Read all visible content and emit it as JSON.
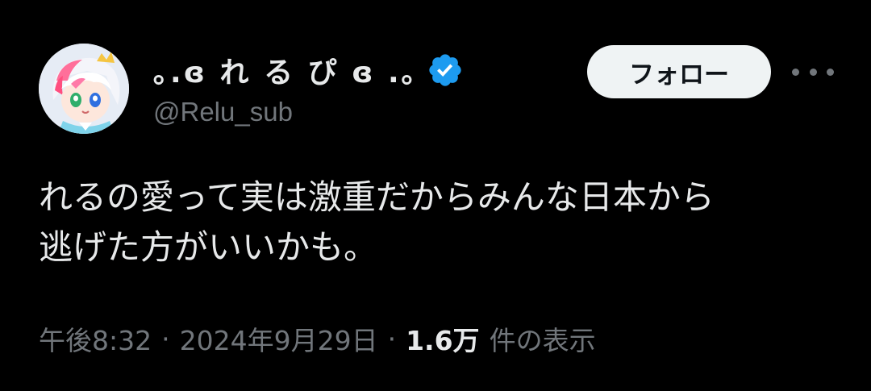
{
  "author": {
    "display_name": "｡.ɞ れ る ぴ ɞ .｡",
    "handle": "@Relu_sub",
    "verified": true,
    "avatar_icon": "anime-character-avatar"
  },
  "actions": {
    "follow_label": "フォロー",
    "more_icon": "more-dots-icon"
  },
  "tweet": {
    "text": "れるの愛って実は激重だからみんな日本から\n逃げた方がいいかも。"
  },
  "meta": {
    "time": "午後8:32",
    "separator": "·",
    "date": "2024年9月29日",
    "views_count": "1.6万",
    "views_label": "件の表示"
  },
  "colors": {
    "background": "#000000",
    "primary_text": "#e7e9ea",
    "secondary_text": "#71767b",
    "verified_badge": "#1d9bf0",
    "follow_button_bg": "#eff3f4"
  }
}
